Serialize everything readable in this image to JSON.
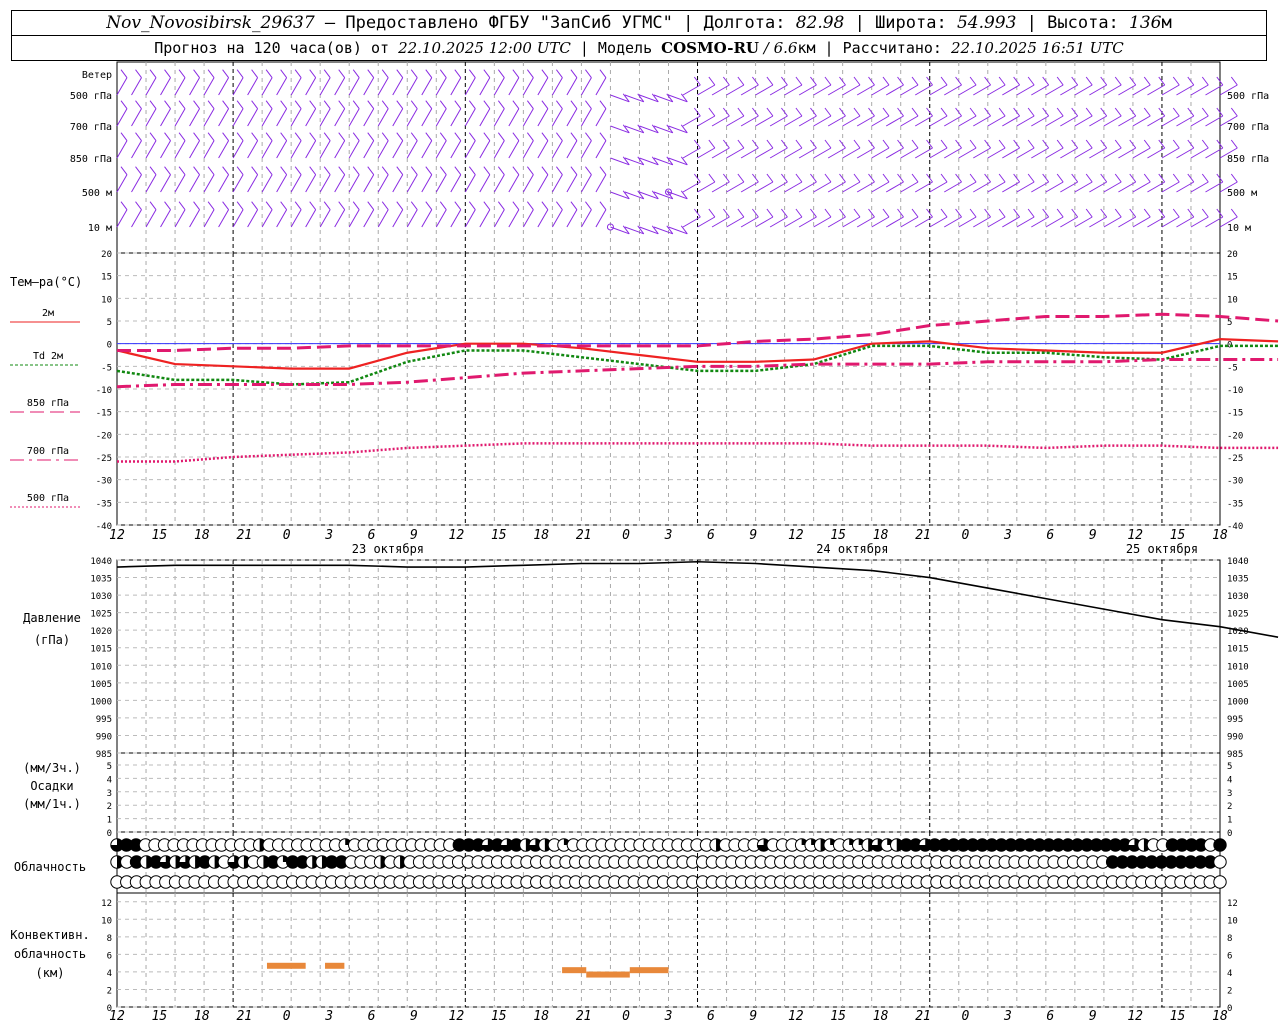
{
  "header": {
    "station": "Nov_Novosibirsk_29637",
    "provided_by": " — Предоставлено ФГБУ \"ЗапСиб УГМС\" | Долгота: ",
    "lon": "82.98",
    "lat_label": " | Широта: ",
    "lat": "54.993",
    "alt_label": " | Высота: ",
    "alt": "136",
    "alt_unit": "м",
    "forecast_label": "Прогноз на 120 часа(ов) от ",
    "forecast_time": "22.10.2025 12:00 UTC",
    "model_label": " | Модель ",
    "model": "COSMO-RU",
    "resolution": " / 6.6",
    "res_unit": "км",
    "calc_label": " | Рассчитано: ",
    "calc_time": "22.10.2025 16:51 UTC"
  },
  "chart_data": [
    {
      "type": "wind_barbs",
      "levels": [
        "Ветер",
        "500 гПа",
        "700 гПа",
        "850 гПа",
        "500 м",
        "10 м"
      ],
      "right_levels": [
        "500 гПа",
        "700 гПа",
        "850 гПа",
        "500 м",
        "10 м"
      ]
    },
    {
      "type": "line",
      "title": "Тем—ра(°C)",
      "ylim": [
        -40,
        20
      ],
      "yticks": [
        20,
        15,
        10,
        5,
        0,
        -5,
        -10,
        -15,
        -20,
        -25,
        -30,
        -35,
        -40
      ],
      "x_hours": [
        0,
        6,
        12,
        18,
        24,
        30,
        36,
        42,
        48,
        54,
        60,
        66,
        72,
        78,
        84,
        90,
        96,
        102,
        108,
        114,
        120
      ],
      "series": [
        {
          "name": "2м",
          "color": "#ee2222",
          "values": [
            -1.5,
            -4.5,
            -5,
            -5.5,
            -5.5,
            -2,
            0,
            0,
            -1,
            -2.5,
            -4,
            -4,
            -3.5,
            0,
            0.5,
            -1,
            -1.5,
            -2,
            -2,
            1,
            0.5
          ]
        },
        {
          "name": "Td 2м",
          "color": "#118811",
          "values": [
            -6,
            -8,
            -8,
            -9,
            -8.5,
            -4,
            -1.5,
            -1.5,
            -3,
            -4.5,
            -6,
            -6,
            -4.5,
            -0.5,
            -0.5,
            -2,
            -2,
            -3,
            -3.5,
            -0.5,
            -0.5
          ]
        },
        {
          "name": "850 гПа",
          "color": "#e0196e",
          "values": [
            -1.5,
            -1.5,
            -1,
            -1,
            -0.5,
            -0.5,
            -0.5,
            -0.5,
            -0.5,
            -0.5,
            -0.5,
            0.5,
            1,
            2,
            4,
            5,
            6,
            6,
            6.5,
            6,
            5
          ]
        },
        {
          "name": "700 гПа",
          "color": "#e0196e",
          "values": [
            -9.5,
            -9,
            -9,
            -9,
            -9,
            -8.5,
            -7.5,
            -6.5,
            -6,
            -5.5,
            -5,
            -5,
            -4.5,
            -4.5,
            -4.5,
            -4,
            -4,
            -4,
            -3.5,
            -3.5,
            -3.5
          ]
        },
        {
          "name": "500 гПа",
          "color": "#e0196e",
          "values": [
            -26,
            -26,
            -25,
            -24.5,
            -24,
            -23,
            -22.5,
            -22,
            -22,
            -22,
            -22,
            -22,
            -22,
            -22.5,
            -22.5,
            -22.5,
            -23,
            -22.5,
            -22.5,
            -23,
            -23
          ]
        }
      ]
    },
    {
      "type": "line",
      "ylabel": "Давление",
      "yunit": "(гПа)",
      "ylim": [
        985,
        1040
      ],
      "yticks": [
        1040,
        1035,
        1030,
        1025,
        1020,
        1015,
        1010,
        1005,
        1000,
        995,
        990,
        985
      ],
      "x_hours": [
        0,
        6,
        12,
        18,
        24,
        30,
        36,
        42,
        48,
        54,
        60,
        66,
        72,
        78,
        84,
        90,
        96,
        102,
        108,
        114,
        120
      ],
      "series": [
        {
          "name": "pressure",
          "color": "#000000",
          "values": [
            1038,
            1038.5,
            1038.5,
            1038.5,
            1038.5,
            1038,
            1038,
            1038.5,
            1039,
            1039,
            1039.5,
            1039,
            1038,
            1037,
            1035,
            1032,
            1029,
            1026,
            1023,
            1021,
            1018
          ]
        }
      ]
    },
    {
      "type": "bar",
      "ylabel": "Осадки",
      "yunit_top": "(мм/3ч.)",
      "yunit_bottom": "(мм/1ч.)",
      "ylim": [
        0,
        5
      ],
      "yticks": [
        5,
        4,
        3,
        2,
        1,
        0
      ],
      "values": []
    },
    {
      "type": "cloud_cover",
      "title": "Облачность",
      "rows": [
        "344000000000000200000000100000000000444343423201000000000000000200003000112101123124434444444444444444444443200444404",
        "204243232420320241442244000202000000000000000000000000000000000000000000000000000000000000000000000000444444444440",
        "000000000000000000000000000000000000000000000000000000000000000000000000000000000000000000000000000000000000000000"
      ]
    },
    {
      "type": "bar",
      "title": "Конвективн. облачность",
      "yunit": "(км)",
      "ylim": [
        0,
        13
      ],
      "yticks": [
        12,
        10,
        8,
        6,
        4,
        2,
        0
      ],
      "color": "#e8883a",
      "segments": [
        {
          "start": 15.5,
          "end": 19.5,
          "value": 4.7
        },
        {
          "start": 21.5,
          "end": 23.5,
          "value": 4.7
        },
        {
          "start": 46,
          "end": 48.5,
          "value": 4.2
        },
        {
          "start": 48.5,
          "end": 53,
          "value": 3.7
        },
        {
          "start": 53,
          "end": 57,
          "value": 4.2
        }
      ]
    }
  ],
  "x_axis": {
    "tick_labels": [
      "12",
      "15",
      "18",
      "21",
      "0",
      "3",
      "6",
      "9",
      "12",
      "15",
      "18",
      "21",
      "0",
      "3",
      "6",
      "9",
      "12",
      "15",
      "18",
      "21",
      "0",
      "3",
      "6",
      "9",
      "12",
      "15",
      "18"
    ],
    "date_labels": [
      "23 октября",
      "24 октября",
      "25 октября"
    ]
  },
  "colors": {
    "wind": "#8a2be2",
    "grid": "#999999",
    "freezing_line": "#3333ff"
  }
}
